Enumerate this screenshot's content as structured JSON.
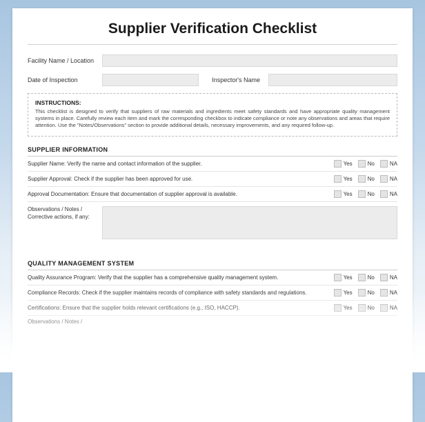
{
  "title": "Supplier Verification Checklist",
  "header": {
    "facility_label": "Facility Name / Location",
    "date_label": "Date of Inspection",
    "inspector_label": "Inspector's Name"
  },
  "instructions": {
    "heading": "INSTRUCTIONS:",
    "body": "This checklist is designed to verify that suppliers of raw materials and ingredients meet safety standards and have appropriate quality management systems in place. Carefully review each item and mark the corresponding checkbox to indicate compliance or note any observations and areas that require attention. Use the \"Notes/Observations\" section to provide additional details, necessary improvements, and any required follow-up."
  },
  "options": {
    "yes": "Yes",
    "no": "No",
    "na": "NA"
  },
  "notes_label": "Observations / Notes / Corrective actions, if any:",
  "sections": [
    {
      "title": "SUPPLIER INFORMATION",
      "items": [
        "Supplier Name: Verify the name and contact information of the supplier.",
        "Supplier Approval: Check if the supplier has been approved for use.",
        "Approval Documentation: Ensure that documentation of supplier approval is available."
      ]
    },
    {
      "title": "QUALITY MANAGEMENT SYSTEM",
      "items": [
        "Quality Assurance Program: Verify that the supplier has a comprehensive quality management system.",
        "Compliance Records: Check if the supplier maintains records of compliance with safety standards and regulations.",
        "Certifications: Ensure that the supplier holds relevant certifications (e.g., ISO, HACCP)."
      ]
    }
  ],
  "truncated_notes_label": "Observations / Notes /"
}
